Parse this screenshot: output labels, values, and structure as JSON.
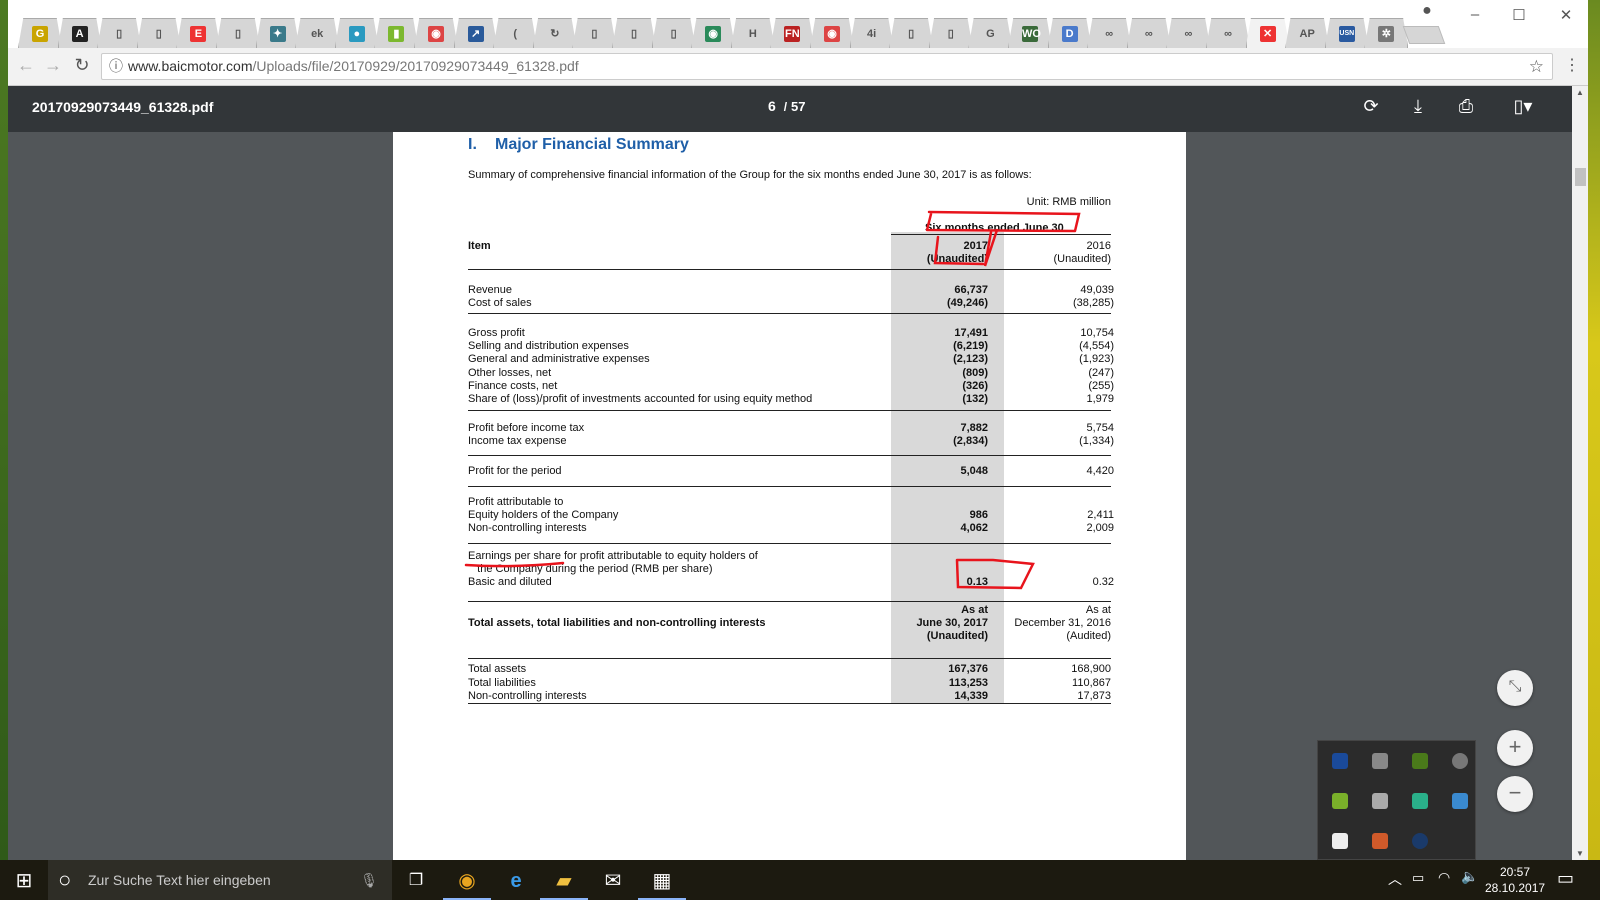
{
  "browser": {
    "tabs": [
      {
        "icon": "gt-icon",
        "color": "#c9a400",
        "glyph": "G"
      },
      {
        "icon": "acrobat-icon",
        "color": "#222",
        "glyph": "A"
      },
      {
        "icon": "page-icon",
        "color": "",
        "glyph": "▯"
      },
      {
        "icon": "page-icon",
        "color": "",
        "glyph": "▯"
      },
      {
        "icon": "red-e-icon",
        "color": "#e33",
        "glyph": "E"
      },
      {
        "icon": "page-icon",
        "color": "",
        "glyph": "▯"
      },
      {
        "icon": "eagle-icon",
        "color": "#3a7a8a",
        "glyph": "✦"
      },
      {
        "icon": "ek-icon",
        "color": "",
        "glyph": "ek"
      },
      {
        "icon": "circle-icon",
        "color": "#2a9ac0",
        "glyph": "●"
      },
      {
        "icon": "chart-icon",
        "color": "#7cb82f",
        "glyph": "▮"
      },
      {
        "icon": "globe-red-icon",
        "color": "#d44",
        "glyph": "◉"
      },
      {
        "icon": "trend-icon",
        "color": "#2a5a9a",
        "glyph": "↗"
      },
      {
        "icon": "loading-icon",
        "color": "",
        "glyph": "("
      },
      {
        "icon": "loading-icon",
        "color": "",
        "glyph": "↻"
      },
      {
        "icon": "page-icon",
        "color": "",
        "glyph": "▯"
      },
      {
        "icon": "page-icon",
        "color": "",
        "glyph": "▯"
      },
      {
        "icon": "page-icon",
        "color": "",
        "glyph": "▯"
      },
      {
        "icon": "globe-icon",
        "color": "#2a8a5a",
        "glyph": "◉"
      },
      {
        "icon": "h-icon",
        "color": "",
        "glyph": "H"
      },
      {
        "icon": "fn-icon",
        "color": "#b22",
        "glyph": "FN"
      },
      {
        "icon": "globe-red-icon",
        "color": "#d44",
        "glyph": "◉"
      },
      {
        "icon": "4i-icon",
        "color": "",
        "glyph": "4i"
      },
      {
        "icon": "page-icon",
        "color": "",
        "glyph": "▯"
      },
      {
        "icon": "page-icon",
        "color": "",
        "glyph": "▯"
      },
      {
        "icon": "google-icon",
        "color": "",
        "glyph": "G"
      },
      {
        "icon": "wo-icon",
        "color": "#3a6a3a",
        "glyph": "WO"
      },
      {
        "icon": "deepl-icon",
        "color": "#4a7acb",
        "glyph": "D"
      },
      {
        "icon": "baic-icon",
        "color": "",
        "glyph": "∞"
      },
      {
        "icon": "baic-icon",
        "color": "",
        "glyph": "∞"
      },
      {
        "icon": "baic-icon",
        "color": "",
        "glyph": "∞"
      },
      {
        "icon": "baic-icon",
        "color": "",
        "glyph": "∞"
      },
      {
        "icon": "close-red-icon",
        "color": "#e33",
        "glyph": "✕",
        "active": true
      },
      {
        "icon": "ap-icon",
        "color": "",
        "glyph": "AP"
      },
      {
        "icon": "usn-icon",
        "color": "#2a5aa0",
        "glyph": "USN"
      },
      {
        "icon": "mercedes-icon",
        "color": "#777",
        "glyph": "✲"
      }
    ],
    "url_host": "www.baicmotor.com",
    "url_path": "/Uploads/file/20170929/20170929073449_61328.pdf"
  },
  "pdf": {
    "filename": "20170929073449_61328.pdf",
    "current_page": "6",
    "separator": "/",
    "total_pages": "57"
  },
  "document": {
    "heading_num": "I.",
    "heading": "Major Financial Summary",
    "intro": "Summary of comprehensive financial information of the Group for the six months ended June 30, 2017 is as follows:",
    "unit": "Unit: RMB million",
    "period_header": "Six months ended June 30",
    "item_header": "Item",
    "col2017": [
      "2017",
      "(Unaudited)"
    ],
    "col2016": [
      "2016",
      "(Unaudited)"
    ],
    "groups": [
      [
        {
          "label": "Revenue",
          "v17": "66,737",
          "v16": "49,039"
        },
        {
          "label": "Cost of sales",
          "v17": "(49,246)",
          "v16": "(38,285)"
        }
      ],
      [
        {
          "label": "Gross profit",
          "v17": "17,491",
          "v16": "10,754"
        },
        {
          "label": "Selling and distribution expenses",
          "v17": "(6,219)",
          "v16": "(4,554)"
        },
        {
          "label": "General and administrative expenses",
          "v17": "(2,123)",
          "v16": "(1,923)"
        },
        {
          "label": "Other losses, net",
          "v17": "(809)",
          "v16": "(247)"
        },
        {
          "label": "Finance costs, net",
          "v17": "(326)",
          "v16": "(255)"
        },
        {
          "label": "Share of (loss)/profit of investments accounted for using equity method",
          "v17": "(132)",
          "v16": "1,979"
        }
      ],
      [
        {
          "label": "Profit before income tax",
          "v17": "7,882",
          "v16": "5,754"
        },
        {
          "label": "Income tax expense",
          "v17": "(2,834)",
          "v16": "(1,334)"
        }
      ],
      [
        {
          "label": "Profit for the period",
          "v17": "5,048",
          "v16": "4,420"
        }
      ],
      [
        {
          "label": "Profit attributable to",
          "v17": "",
          "v16": ""
        },
        {
          "label": "Equity holders of the Company",
          "v17": "986",
          "v16": "2,411"
        },
        {
          "label": "Non-controlling interests",
          "v17": "4,062",
          "v16": "2,009"
        }
      ],
      [
        {
          "label": "Earnings per share for profit attributable to equity holders of",
          "v17": "",
          "v16": ""
        },
        {
          "label": "   the Company during the period (RMB per share)",
          "v17": "",
          "v16": ""
        },
        {
          "label": "Basic and diluted",
          "v17": "0.13",
          "v16": "0.32"
        }
      ]
    ],
    "bs_header": "Total assets, total liabilities and non-controlling interests",
    "bs_col1": [
      "As at",
      "June 30, 2017",
      "(Unaudited)"
    ],
    "bs_col2": [
      "As at",
      "December 31, 2016",
      "(Audited)"
    ],
    "bs_rows": [
      {
        "label": "Total assets",
        "v17": "167,376",
        "v16": "168,900"
      },
      {
        "label": "Total liabilities",
        "v17": "113,253",
        "v16": "110,867"
      },
      {
        "label": "Non-controlling interests",
        "v17": "14,339",
        "v16": "17,873"
      }
    ]
  },
  "viewer": {
    "zoom_in": "+",
    "zoom_out": "−",
    "fit": "⤡"
  },
  "taskbar": {
    "search_placeholder": "Zur Suche Text hier eingeben",
    "time": "20:57",
    "date": "28.10.2017"
  },
  "colors": {
    "annotation": "#e8141c",
    "toolbar": "#323639",
    "viewer_bg": "#525659"
  }
}
